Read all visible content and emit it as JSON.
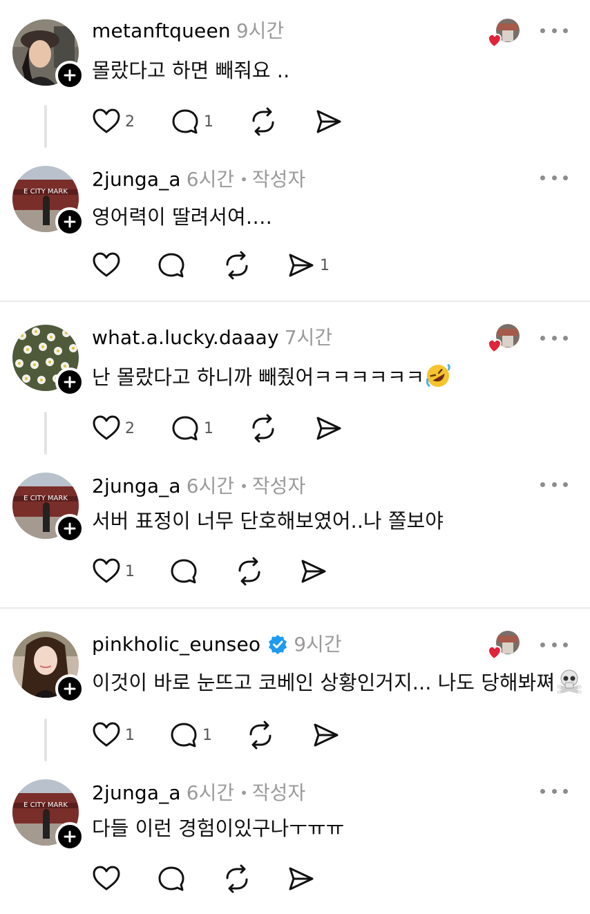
{
  "posts": [
    {
      "username": "metanftqueen",
      "time": "9시간",
      "text": "몰랐다고 하면 빼줘요 ..",
      "likes": "2",
      "replies": "1",
      "reposts": "",
      "shares": "",
      "avatar": "woman-black-hat"
    },
    {
      "username": "2junga_a",
      "time": "6시간",
      "author_label": "작성자",
      "text": "영어력이 딸려서여….",
      "likes": "",
      "replies": "",
      "reposts": "",
      "shares": "1",
      "avatar": "city-market"
    },
    {
      "username": "what.a.lucky.daaay",
      "time": "7시간",
      "text": "난 몰랐다고 하니까 빼줬어ㅋㅋㅋㅋㅋㅋ",
      "emoji": "rolling-laughing-emoji",
      "likes": "2",
      "replies": "1",
      "reposts": "",
      "shares": "",
      "avatar": "daisy-flowers"
    },
    {
      "username": "2junga_a",
      "time": "6시간",
      "author_label": "작성자",
      "text": "서버 표정이 너무 단호해보였어..나 쫄보야",
      "likes": "1",
      "replies": "",
      "reposts": "",
      "shares": "",
      "avatar": "city-market"
    },
    {
      "username": "pinkholic_eunseo",
      "time": "9시간",
      "text": "이것이 바로 눈뜨고 코베인 상황인거지... 나도 당해봐쪄",
      "emoji": "skull-crossbones-emoji",
      "likes": "1",
      "replies": "1",
      "reposts": "",
      "shares": "",
      "avatar": "woman-long-hair"
    },
    {
      "username": "2junga_a",
      "time": "6시간",
      "author_label": "작성자",
      "text": "다들 이런 경험이있구나ㅜㅠㅠ",
      "likes": "",
      "replies": "",
      "reposts": "",
      "shares": "",
      "avatar": "city-market"
    }
  ],
  "colors": {
    "muted": "#9a9a9a",
    "like_heart": "#e0243a",
    "verified": "#1d9bf0"
  }
}
